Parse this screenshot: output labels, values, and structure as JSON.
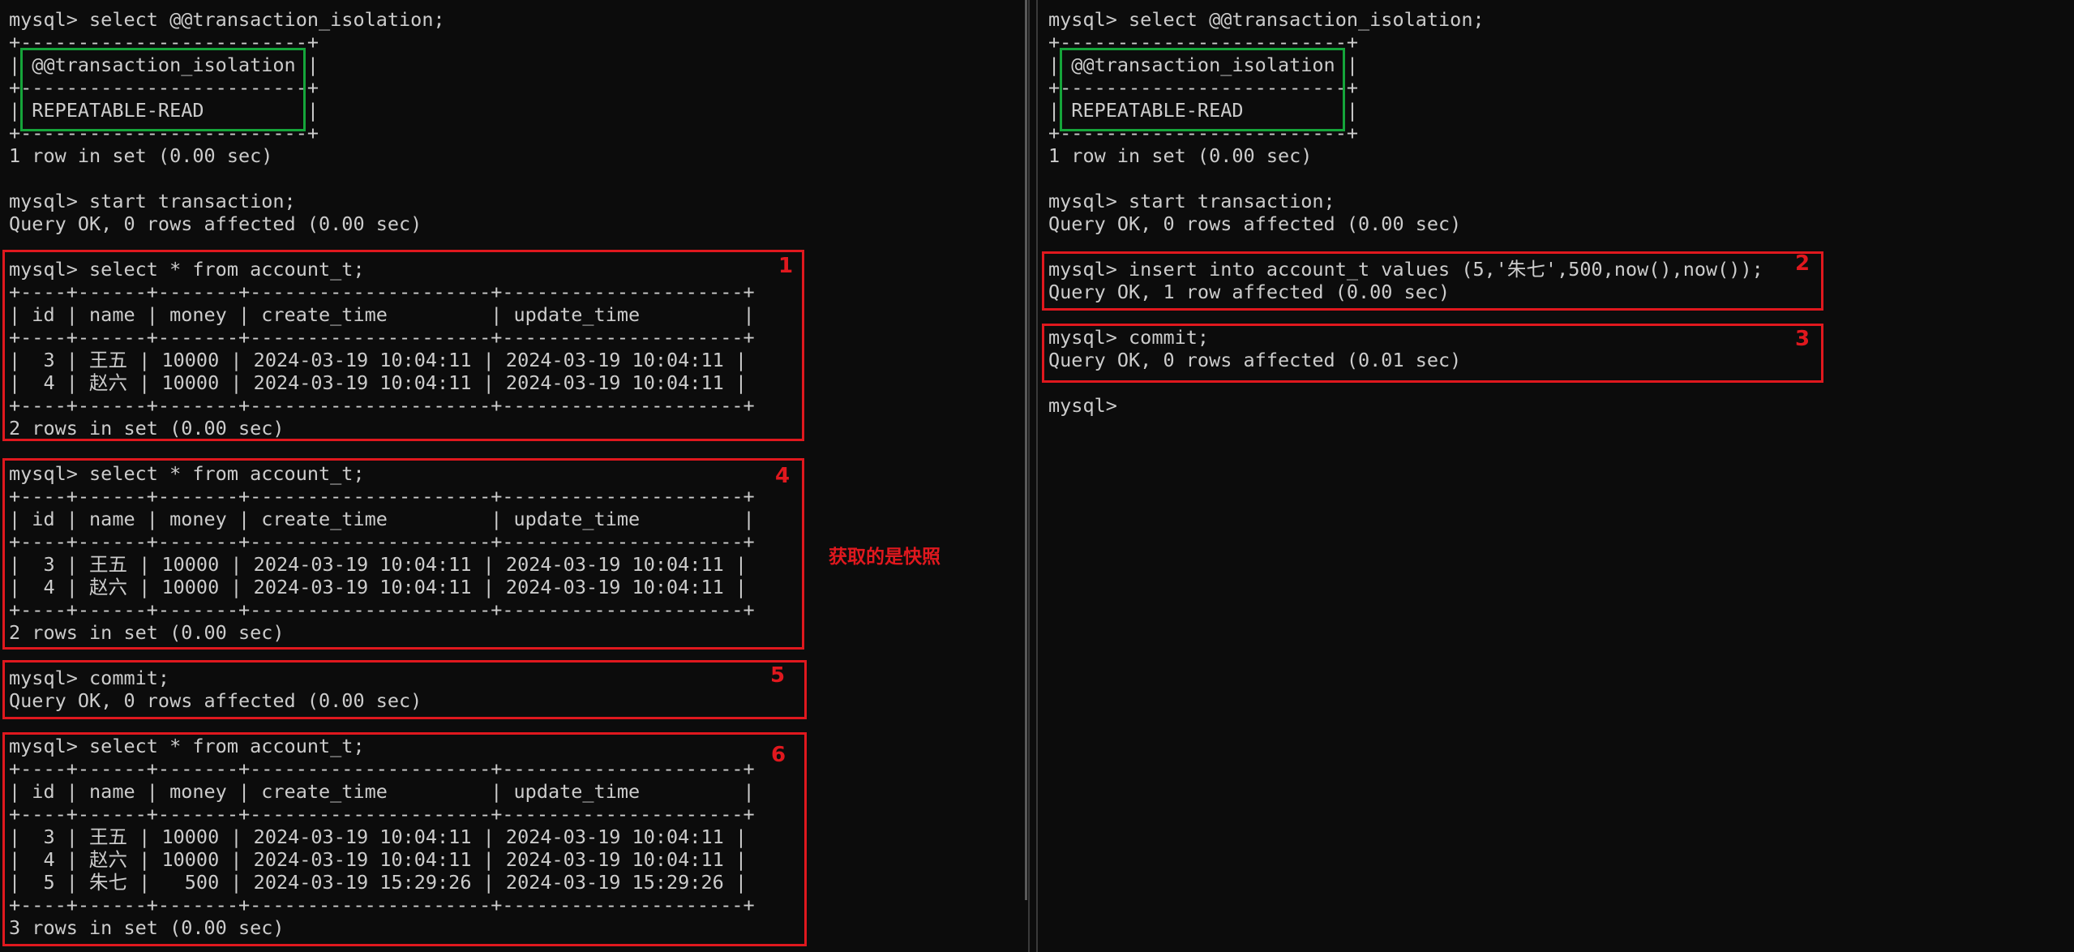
{
  "left_pane": {
    "lines": [
      "mysql> select @@transaction_isolation;",
      "+-------------------------+",
      "| @@transaction_isolation |",
      "+-------------------------+",
      "| REPEATABLE-READ         |",
      "+-------------------------+",
      "1 row in set (0.00 sec)",
      "",
      "mysql> start transaction;",
      "Query OK, 0 rows affected (0.00 sec)",
      "",
      "mysql> select * from account_t;",
      "+----+------+-------+---------------------+---------------------+",
      "| id | name | money | create_time         | update_time         |",
      "+----+------+-------+---------------------+---------------------+",
      "|  3 | 王五 | 10000 | 2024-03-19 10:04:11 | 2024-03-19 10:04:11 |",
      "|  4 | 赵六 | 10000 | 2024-03-19 10:04:11 | 2024-03-19 10:04:11 |",
      "+----+------+-------+---------------------+---------------------+",
      "2 rows in set (0.00 sec)",
      "",
      "mysql> select * from account_t;",
      "+----+------+-------+---------------------+---------------------+",
      "| id | name | money | create_time         | update_time         |",
      "+----+------+-------+---------------------+---------------------+",
      "|  3 | 王五 | 10000 | 2024-03-19 10:04:11 | 2024-03-19 10:04:11 |",
      "|  4 | 赵六 | 10000 | 2024-03-19 10:04:11 | 2024-03-19 10:04:11 |",
      "+----+------+-------+---------------------+---------------------+",
      "2 rows in set (0.00 sec)",
      "",
      "mysql> commit;",
      "Query OK, 0 rows affected (0.00 sec)",
      "",
      "mysql> select * from account_t;",
      "+----+------+-------+---------------------+---------------------+",
      "| id | name | money | create_time         | update_time         |",
      "+----+------+-------+---------------------+---------------------+",
      "|  3 | 王五 | 10000 | 2024-03-19 10:04:11 | 2024-03-19 10:04:11 |",
      "|  4 | 赵六 | 10000 | 2024-03-19 10:04:11 | 2024-03-19 10:04:11 |",
      "|  5 | 朱七 |   500 | 2024-03-19 15:29:26 | 2024-03-19 15:29:26 |",
      "+----+------+-------+---------------------+---------------------+",
      "3 rows in set (0.00 sec)"
    ]
  },
  "right_pane": {
    "lines": [
      "mysql> select @@transaction_isolation;",
      "+-------------------------+",
      "| @@transaction_isolation |",
      "+-------------------------+",
      "| REPEATABLE-READ         |",
      "+-------------------------+",
      "1 row in set (0.00 sec)",
      "",
      "mysql> start transaction;",
      "Query OK, 0 rows affected (0.00 sec)",
      "",
      "mysql> insert into account_t values (5,'朱七',500,now(),now());",
      "Query OK, 1 row affected (0.00 sec)",
      "",
      "mysql> commit;",
      "Query OK, 0 rows affected (0.01 sec)",
      "",
      "mysql>"
    ]
  },
  "step_labels": {
    "s1": "1",
    "s2": "2",
    "s3": "3",
    "s4": "4",
    "s5": "5",
    "s6": "6"
  },
  "annotation": "获取的是快照",
  "colors": {
    "background": "#0c0c0c",
    "text": "#cccccc",
    "highlight_red": "#e0181e",
    "highlight_green": "#15a53a"
  }
}
